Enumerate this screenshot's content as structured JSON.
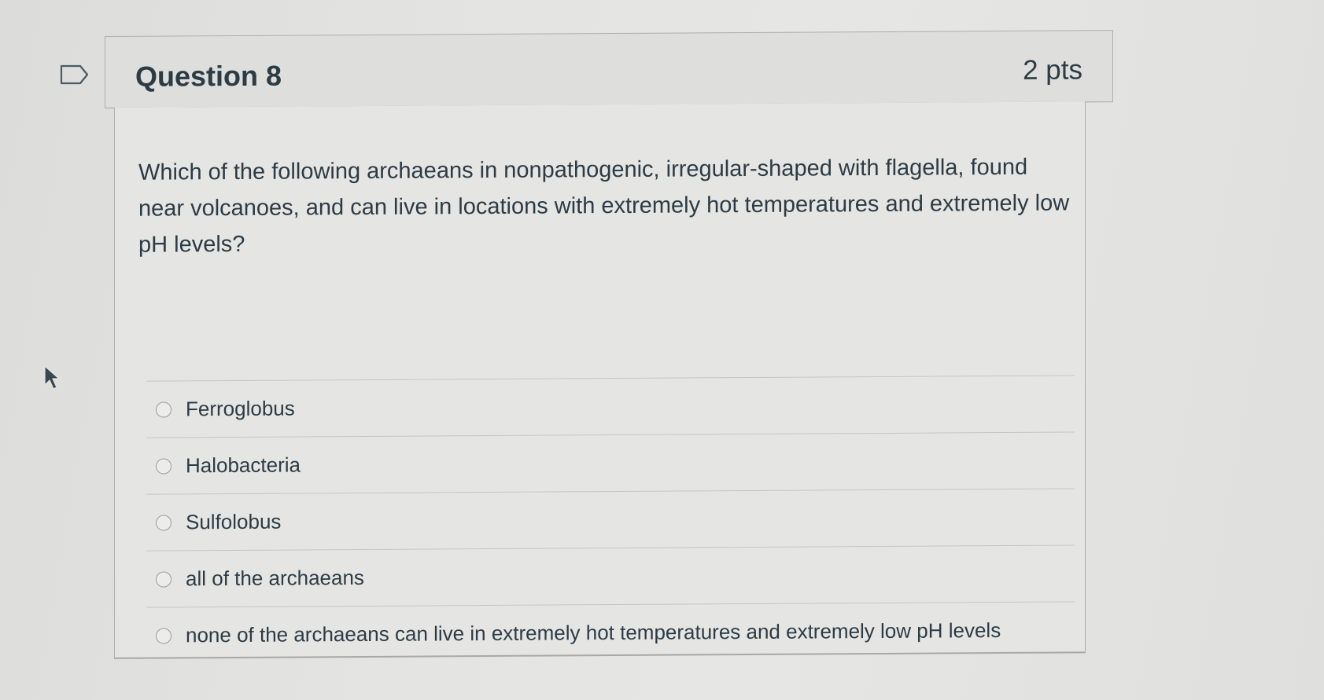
{
  "question": {
    "title": "Question 8",
    "points": "2 pts",
    "text": "Which of the following archaeans in nonpathogenic, irregular-shaped with flagella, found near volcanoes, and can live in locations with extremely hot temperatures and extremely low pH levels?"
  },
  "answers": [
    {
      "label": "Ferroglobus"
    },
    {
      "label": "Halobacteria"
    },
    {
      "label": "Sulfolobus"
    },
    {
      "label": "all of the archaeans"
    },
    {
      "label": "none of the archaeans can live in extremely hot temperatures and extremely low pH levels"
    }
  ],
  "colors": {
    "text": "#2d3b45",
    "header_bg": "#dededc",
    "body_bg": "#e5e5e3",
    "border": "#aeaeac"
  },
  "icons": {
    "flag": "bookmark-flag-icon",
    "cursor": "mouse-pointer-icon",
    "radio": "radio-button-icon"
  }
}
